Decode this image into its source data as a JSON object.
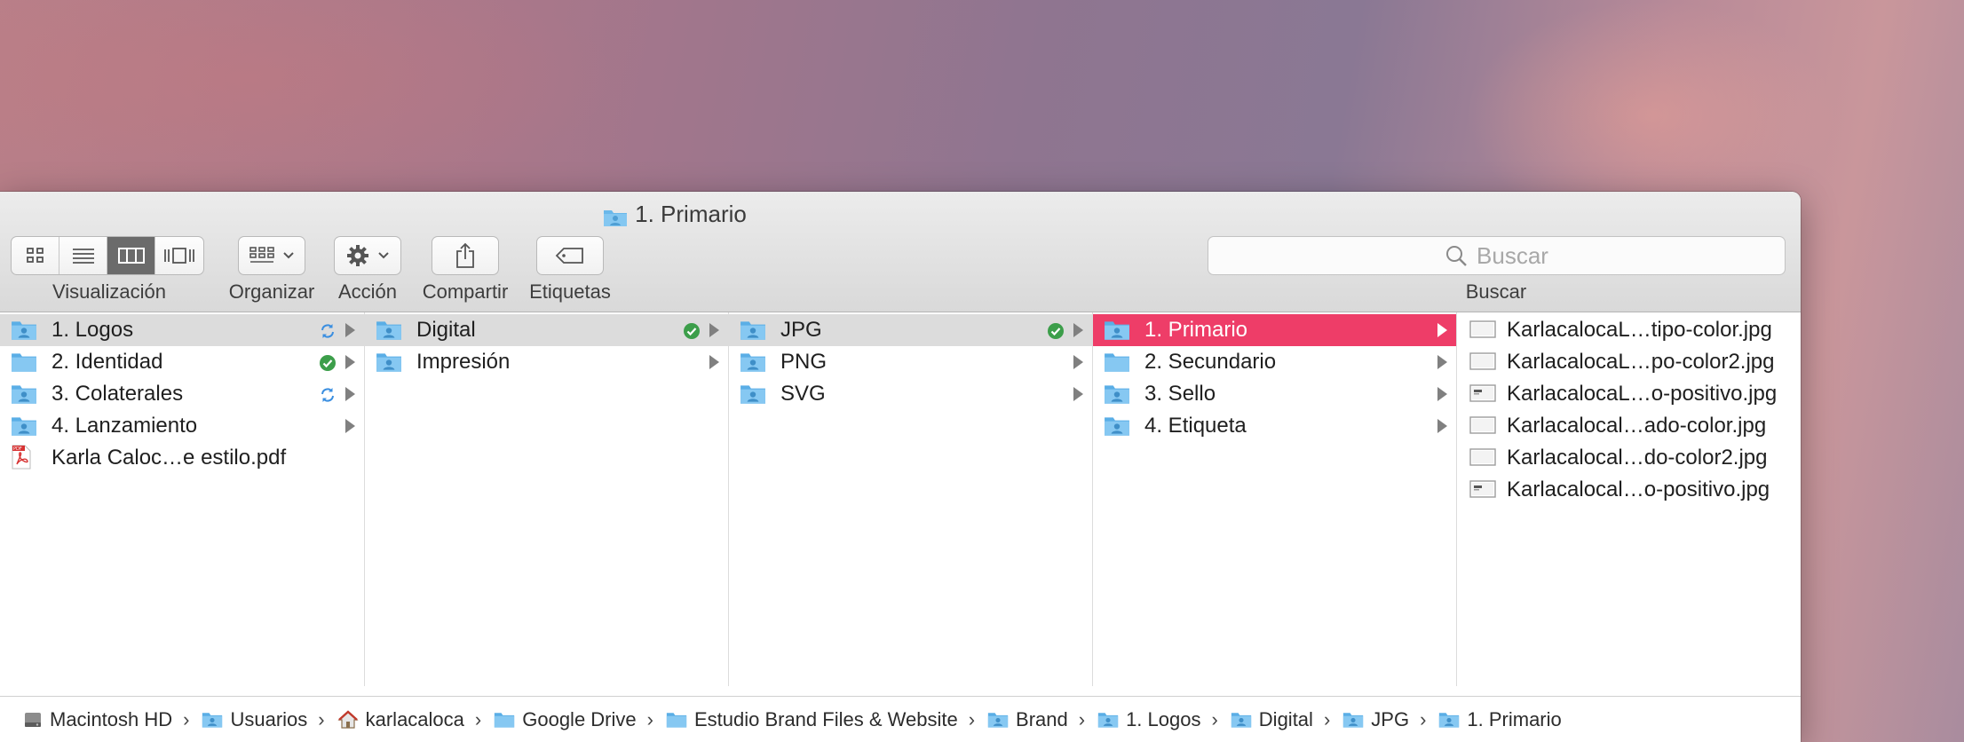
{
  "window": {
    "title": "1. Primario",
    "title_icon": "folder-icon"
  },
  "toolbar": {
    "view_label": "Visualización",
    "view_modes": [
      "icon-view-icon",
      "list-view-icon",
      "column-view-icon",
      "coverflow-view-icon"
    ],
    "view_active": "column-view-icon",
    "arrange_label": "Organizar",
    "action_label": "Acción",
    "share_label": "Compartir",
    "tags_label": "Etiquetas",
    "search_placeholder": "Buscar",
    "search_label": "Buscar"
  },
  "columns": [
    {
      "items": [
        {
          "name": "1. Logos",
          "type": "folder-user",
          "status": "sync",
          "arrow": true,
          "selected": "gray"
        },
        {
          "name": "2. Identidad",
          "type": "folder",
          "status": "check",
          "arrow": true
        },
        {
          "name": "3. Colaterales",
          "type": "folder-user",
          "status": "sync",
          "arrow": true
        },
        {
          "name": "4. Lanzamiento",
          "type": "folder-user",
          "arrow": true
        },
        {
          "name": "Karla Caloc…e estilo.pdf",
          "type": "pdf"
        }
      ]
    },
    {
      "items": [
        {
          "name": "Digital",
          "type": "folder-user",
          "status": "check",
          "arrow": true,
          "selected": "gray"
        },
        {
          "name": "Impresión",
          "type": "folder-user",
          "arrow": true
        }
      ]
    },
    {
      "items": [
        {
          "name": "JPG",
          "type": "folder-user",
          "status": "check",
          "arrow": true,
          "selected": "gray"
        },
        {
          "name": "PNG",
          "type": "folder-user",
          "arrow": true
        },
        {
          "name": "SVG",
          "type": "folder-user",
          "arrow": true
        }
      ]
    },
    {
      "items": [
        {
          "name": "1. Primario",
          "type": "folder-user",
          "arrow": true,
          "selected": "pink"
        },
        {
          "name": "2. Secundario",
          "type": "folder",
          "arrow": true
        },
        {
          "name": "3. Sello",
          "type": "folder-user",
          "arrow": true
        },
        {
          "name": "4. Etiqueta",
          "type": "folder-user",
          "arrow": true
        }
      ]
    },
    {
      "items": [
        {
          "name": "KarlacalocaL…tipo-color.jpg",
          "type": "image"
        },
        {
          "name": "KarlacalocaL…po-color2.jpg",
          "type": "image"
        },
        {
          "name": "KarlacalocaL…o-positivo.jpg",
          "type": "image-logo"
        },
        {
          "name": "Karlacalocal…ado-color.jpg",
          "type": "image"
        },
        {
          "name": "Karlacalocal…do-color2.jpg",
          "type": "image"
        },
        {
          "name": "Karlacalocal…o-positivo.jpg",
          "type": "image-logo"
        }
      ]
    }
  ],
  "pathbar": [
    {
      "name": "Macintosh HD",
      "icon": "hard-drive-icon"
    },
    {
      "name": "Usuarios",
      "icon": "folder-user-icon"
    },
    {
      "name": "karlacaloca",
      "icon": "home-icon"
    },
    {
      "name": "Google Drive",
      "icon": "folder-icon"
    },
    {
      "name": "Estudio Brand Files & Website",
      "icon": "folder-icon"
    },
    {
      "name": "Brand",
      "icon": "folder-user-icon"
    },
    {
      "name": "1. Logos",
      "icon": "folder-user-icon"
    },
    {
      "name": "Digital",
      "icon": "folder-user-icon"
    },
    {
      "name": "JPG",
      "icon": "folder-user-icon"
    },
    {
      "name": "1. Primario",
      "icon": "folder-user-icon"
    }
  ],
  "colors": {
    "selection_accent": "#ee3d68",
    "folder_blue": "#6ab8ea",
    "check_green": "#3c9e4a",
    "sync_blue": "#3a8ee0"
  }
}
